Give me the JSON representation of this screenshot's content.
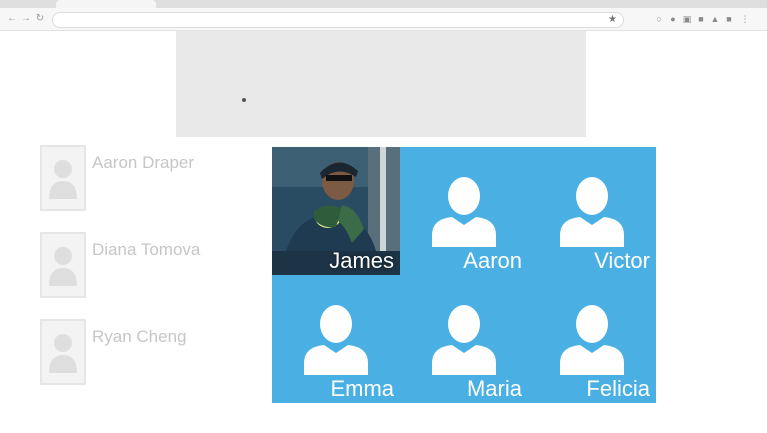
{
  "browser": {
    "back_icon": "back-arrow-icon",
    "forward_icon": "forward-arrow-icon",
    "reload_icon": "reload-icon",
    "tab_title": "",
    "address": "",
    "bookmark_icon": "star-icon",
    "extension_icons": [
      "extension-icon",
      "extension-icon",
      "extension-icon",
      "extension-icon",
      "extension-icon",
      "extension-icon",
      "menu-icon"
    ]
  },
  "contacts": [
    {
      "name": "Aaron Draper",
      "description": ""
    },
    {
      "name": "Diana Tomova",
      "description": ""
    },
    {
      "name": "Ryan Cheng",
      "description": ""
    }
  ],
  "tiles": [
    {
      "label": "James",
      "type": "photo"
    },
    {
      "label": "Aaron",
      "type": "avatar"
    },
    {
      "label": "Victor",
      "type": "avatar"
    },
    {
      "label": "Emma",
      "type": "avatar"
    },
    {
      "label": "Maria",
      "type": "avatar"
    },
    {
      "label": "Felicia",
      "type": "avatar"
    }
  ],
  "colors": {
    "tile_blue": "#4ab0e4",
    "avatar_white": "#ffffff",
    "banner_gray": "#e9e9e9"
  }
}
